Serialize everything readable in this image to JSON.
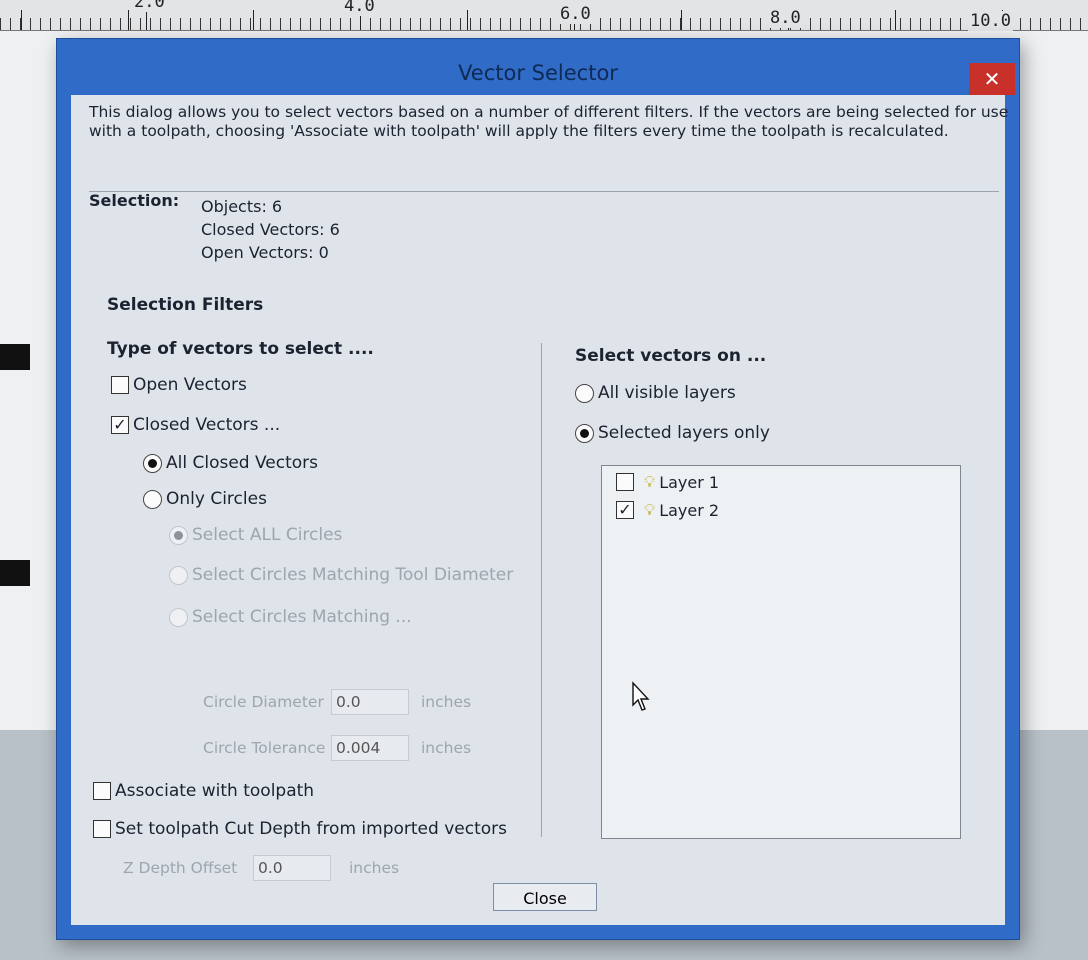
{
  "ruler": {
    "labels": [
      "2.0",
      "4.0",
      "6.0",
      "8.0",
      "10.0"
    ]
  },
  "dialog": {
    "title": "Vector Selector",
    "close_glyph": "✕",
    "intro_text": "This dialog allows you to select vectors based on a number of different filters. If the vectors are being selected for use with a toolpath, choosing 'Associate with toolpath' will apply the filters every time the toolpath is recalculated.",
    "selection": {
      "label": "Selection:",
      "objects": "Objects: 6",
      "closed_vectors": "Closed Vectors: 6",
      "open_vectors": "Open Vectors: 0"
    },
    "filters_title": "Selection Filters",
    "type_title": "Type of vectors to select ....",
    "open_vectors": {
      "label": "Open Vectors",
      "checked": false
    },
    "closed_vectors": {
      "label": "Closed Vectors ...",
      "checked": true
    },
    "all_closed": {
      "label": "All Closed Vectors",
      "selected": true
    },
    "only_circles": {
      "label": "Only Circles",
      "selected": false
    },
    "select_all_circles": {
      "label": "Select ALL Circles",
      "selected": true,
      "enabled": false
    },
    "match_tool_diameter": {
      "label": "Select Circles Matching Tool Diameter",
      "enabled": false
    },
    "match_custom": {
      "label": "Select Circles Matching ...",
      "enabled": false
    },
    "circle_diameter": {
      "label": "Circle Diameter",
      "value": "0.0",
      "unit": "inches"
    },
    "circle_tolerance": {
      "label": "Circle Tolerance",
      "value": "0.004",
      "unit": "inches"
    },
    "associate_toolpath": {
      "label": "Associate with toolpath",
      "checked": false
    },
    "set_cut_depth": {
      "label": "Set toolpath Cut Depth from imported vectors",
      "checked": false
    },
    "z_depth_offset": {
      "label": "Z Depth Offset",
      "value": "0.0",
      "unit": "inches"
    },
    "layers_title": "Select vectors on ...",
    "all_visible_layers": {
      "label": "All visible layers",
      "selected": false
    },
    "selected_layers_only": {
      "label": "Selected layers only",
      "selected": true
    },
    "layers": [
      {
        "name": "Layer 1",
        "checked": false,
        "icon": "lightbulb-icon"
      },
      {
        "name": "Layer 2",
        "checked": true,
        "icon": "lightbulb-icon"
      }
    ],
    "close_button": "Close"
  },
  "colors": {
    "dialog_frame": "#2f6bc7",
    "close_button_red": "#c8302a",
    "client_bg": "#dfe4ea"
  }
}
